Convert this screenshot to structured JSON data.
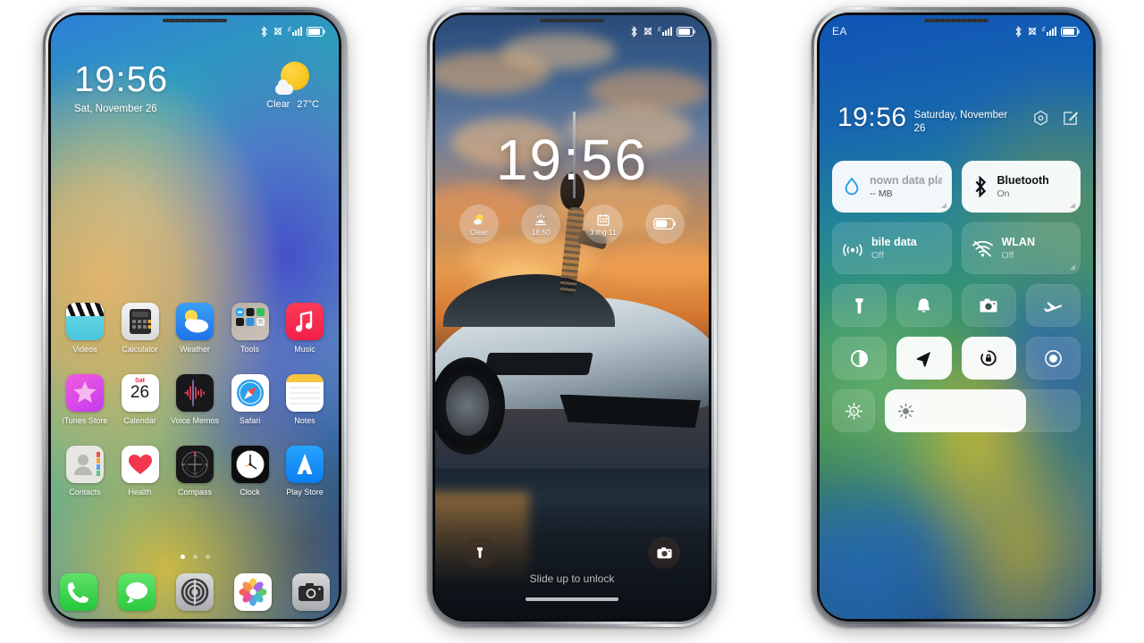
{
  "phone1": {
    "name": "home-screen",
    "status_bar": {
      "icons": [
        "bluetooth-icon",
        "no-sim-icon",
        "signal-icon",
        "battery-icon"
      ]
    },
    "clock": "19:56",
    "date": "Sat, November 26",
    "weather": {
      "icon": "partly-cloudy-icon",
      "condition": "Clear",
      "temperature": "27°C"
    },
    "apps_rows": [
      [
        {
          "label": "Videos",
          "icon": "videos-icon"
        },
        {
          "label": "Calculator",
          "icon": "calculator-icon"
        },
        {
          "label": "Weather",
          "icon": "weather-icon"
        },
        {
          "label": "Tools",
          "icon": "folder-tools-icon"
        },
        {
          "label": "Music",
          "icon": "music-icon"
        }
      ],
      [
        {
          "label": "iTunes Store",
          "icon": "itunes-store-icon"
        },
        {
          "label": "Calendar",
          "icon": "calendar-icon",
          "day_name": "Sat",
          "day_num": "26"
        },
        {
          "label": "Voice Memos",
          "icon": "voice-memos-icon"
        },
        {
          "label": "Safari",
          "icon": "safari-icon"
        },
        {
          "label": "Notes",
          "icon": "notes-icon"
        }
      ],
      [
        {
          "label": "Contacts",
          "icon": "contacts-icon"
        },
        {
          "label": "Health",
          "icon": "health-icon"
        },
        {
          "label": "Compass",
          "icon": "compass-icon"
        },
        {
          "label": "Clock",
          "icon": "clock-icon"
        },
        {
          "label": "Play Store",
          "icon": "play-store-icon"
        }
      ]
    ],
    "page_dots": {
      "count": 3,
      "active": 0
    },
    "dock": [
      {
        "label": "Phone",
        "icon": "phone-icon"
      },
      {
        "label": "Messages",
        "icon": "messages-icon"
      },
      {
        "label": "Settings",
        "icon": "settings-icon"
      },
      {
        "label": "Photos",
        "icon": "photos-icon"
      },
      {
        "label": "Camera",
        "icon": "camera-icon"
      }
    ]
  },
  "phone2": {
    "name": "lock-screen",
    "status_bar": {
      "icons": [
        "bluetooth-icon",
        "no-sim-icon",
        "signal-icon",
        "battery-icon"
      ]
    },
    "clock": "19:56",
    "widgets": [
      {
        "id": "weather-widget",
        "icon": "sun-cloud-icon",
        "label": "Clear"
      },
      {
        "id": "sunset-widget",
        "icon": "sunset-icon",
        "label": "18:50"
      },
      {
        "id": "calendar-widget",
        "icon": "calendar-icon",
        "label": "3 thg 11"
      },
      {
        "id": "battery-widget",
        "icon": "battery-icon",
        "label": ""
      }
    ],
    "bottom_buttons": [
      {
        "id": "flashlight-button",
        "icon": "flashlight-icon"
      },
      {
        "id": "camera-button",
        "icon": "camera-icon"
      }
    ],
    "hint": "Slide up to unlock"
  },
  "phone3": {
    "name": "control-center",
    "carrier": "EA",
    "status_bar": {
      "icons": [
        "bluetooth-icon",
        "no-sim-icon",
        "signal-icon",
        "battery-icon"
      ]
    },
    "clock": "19:56",
    "date": "Saturday, November 26",
    "header_icons": [
      {
        "id": "settings-icon",
        "name": "hex-gear-icon"
      },
      {
        "id": "edit-icon",
        "name": "edit-pencil-icon"
      }
    ],
    "big_tiles": [
      {
        "id": "data-usage-tile",
        "icon": "data-drop-icon",
        "title": "nown data plan",
        "sub": "-- MB",
        "state": "light-faded"
      },
      {
        "id": "bluetooth-tile",
        "icon": "bluetooth-icon",
        "title": "Bluetooth",
        "sub": "On",
        "state": "light"
      },
      {
        "id": "mobile-data-tile",
        "icon": "mobile-data-icon",
        "title": "bile data",
        "sub": "Off",
        "state": "dark"
      },
      {
        "id": "wlan-tile",
        "icon": "wlan-off-icon",
        "title": "WLAN",
        "sub": "Off",
        "state": "dark"
      }
    ],
    "toggle_row_1": [
      {
        "id": "flashlight-toggle",
        "icon": "flashlight-icon",
        "on": false
      },
      {
        "id": "ringer-toggle",
        "icon": "bell-icon",
        "on": false
      },
      {
        "id": "camera-toggle",
        "icon": "camera-icon",
        "on": false
      },
      {
        "id": "airplane-toggle",
        "icon": "airplane-icon",
        "on": false
      }
    ],
    "toggle_row_2": [
      {
        "id": "dark-mode-toggle",
        "icon": "contrast-icon",
        "on": false
      },
      {
        "id": "location-toggle",
        "icon": "location-arrow-icon",
        "on": true
      },
      {
        "id": "rotation-toggle",
        "icon": "rotation-lock-icon",
        "on": true
      },
      {
        "id": "screen-record-toggle",
        "icon": "record-icon",
        "on": false
      }
    ],
    "brightness": {
      "auto_icon": "auto-brightness-icon",
      "slider_icon": "brightness-icon",
      "value": 72
    }
  },
  "colors": {
    "accent_blue": "#1e9bf0",
    "tile_light": "#ffffff",
    "bluetooth_blue": "#1e9bf0",
    "green": "#2cc93f",
    "red": "#f0204a"
  }
}
